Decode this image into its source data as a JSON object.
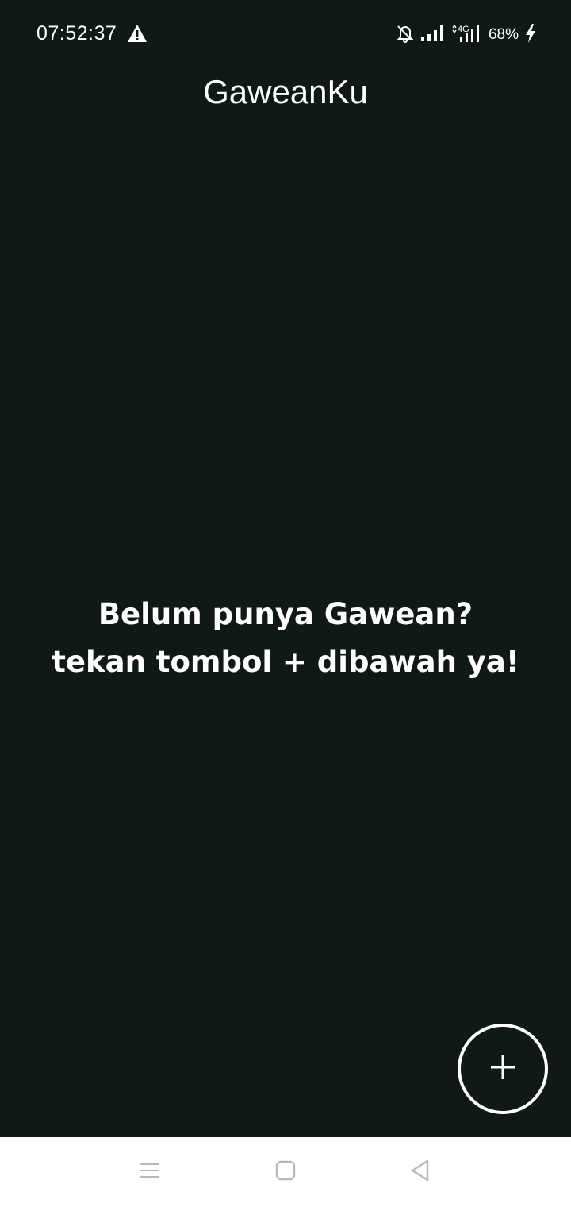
{
  "status_bar": {
    "time": "07:52:37",
    "warning_icon": "warning-triangle-icon",
    "silent_icon": "bell-off-icon",
    "signal_icon": "signal-bars-icon",
    "network_label": "4G",
    "battery": "68%",
    "charging_icon": "lightning-bolt-icon"
  },
  "app": {
    "title": "GaweanKu"
  },
  "main": {
    "empty_message": "Belum punya Gawean? tekan tombol + dibawah ya!"
  },
  "fab": {
    "icon": "plus-icon"
  },
  "nav_bar": {
    "menu_icon": "menu-icon",
    "home_icon": "home-square-icon",
    "back_icon": "back-triangle-icon"
  },
  "colors": {
    "background": "#111818",
    "foreground": "#ffffff",
    "nav_bar_bg": "#ffffff",
    "nav_icon": "#b8b8b8"
  }
}
